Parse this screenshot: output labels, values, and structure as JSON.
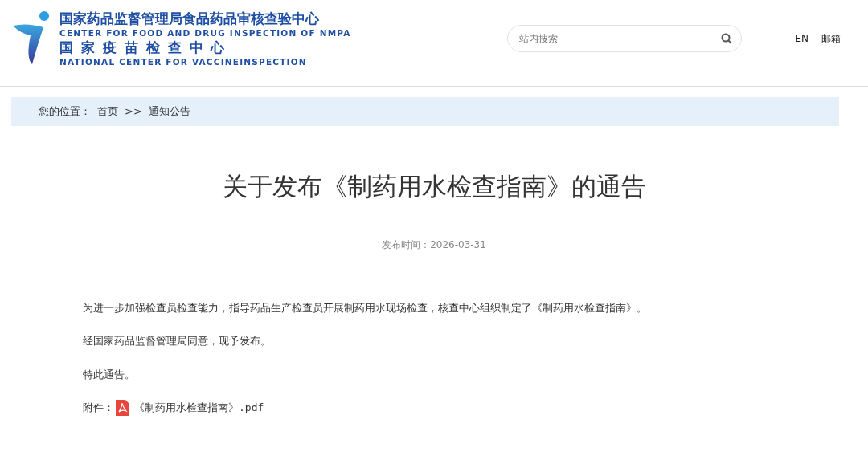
{
  "header": {
    "logo": {
      "title_cn": "国家药品监督管理局食品药品审核查验中心",
      "title_en": "CENTER FOR FOOD AND DRUG INSPECTION OF NMPA",
      "subtitle_cn": "国 家 疫 苗 检 查 中 心",
      "subtitle_en": "NATIONAL CENTER FOR VACCINEINSPECTION"
    },
    "search": {
      "placeholder": "站内搜索"
    },
    "links": [
      "EN",
      "邮箱"
    ]
  },
  "breadcrumb": {
    "label": "您的位置：",
    "items": [
      "首页",
      "通知公告"
    ],
    "separator": ">>"
  },
  "article": {
    "title": "关于发布《制药用水检查指南》的通告",
    "date_label": "发布时间：",
    "date": "2026-03-31",
    "paragraphs": [
      "为进一步加强检查员检查能力，指导药品生产检查员开展制药用水现场检查，核查中心组织制定了《制药用水检查指南》。",
      "经国家药品监督管理局同意，现予发布。",
      "特此通告。"
    ],
    "attachment": {
      "label": "附件：",
      "file": "《制药用水检查指南》.pdf"
    }
  }
}
